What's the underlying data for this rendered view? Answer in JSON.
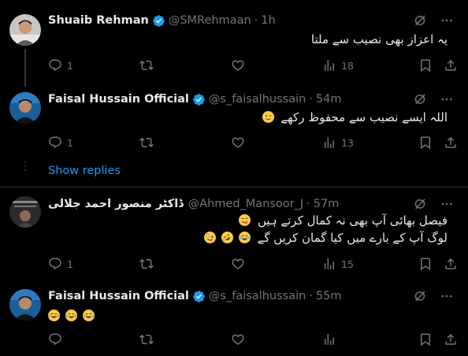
{
  "tweets": [
    {
      "name": "Shuaib Rehman",
      "verified": true,
      "handle": "@SMRehmaan",
      "time": "1h",
      "text_lines": [
        "یہ اعزاز بھی نصیب سے ملتا"
      ],
      "replies": "1",
      "retweets": "",
      "likes": "",
      "views": "18"
    },
    {
      "name": "Faisal Hussain Official",
      "verified": true,
      "handle": "@s_faisalhussain",
      "time": "54m",
      "text_lines": [
        "اللہ ایسے نصیب سے محفوظ رکھے"
      ],
      "replies": "1",
      "retweets": "",
      "likes": "",
      "views": "13"
    },
    {
      "name": "ڈاکٹر منصور احمد جلالی",
      "verified": false,
      "handle": "@Ahmed_Mansoor_J",
      "time": "57m",
      "text_lines": [
        "فیصل بھائی آپ بھی نہ کمال کرتے ہیں",
        "لوگ آپ کے بارے میں کیا گمان کریں گے"
      ],
      "replies": "1",
      "retweets": "",
      "likes": "",
      "views": "15"
    },
    {
      "name": "Faisal Hussain Official",
      "verified": true,
      "handle": "@s_faisalhussain",
      "time": "55m",
      "text_lines": [
        ""
      ],
      "replies": "",
      "retweets": "",
      "likes": "",
      "views": ""
    }
  ],
  "show_replies": "Show replies",
  "dot": "·",
  "colors": {
    "accent": "#1d9bf0",
    "muted": "#71767b",
    "text": "#e7e9ea",
    "background": "#000000"
  },
  "icons": [
    "more-icon",
    "grok-icon",
    "reply-icon",
    "retweet-icon",
    "like-icon",
    "views-icon",
    "bookmark-icon",
    "share-icon",
    "verified-icon"
  ]
}
